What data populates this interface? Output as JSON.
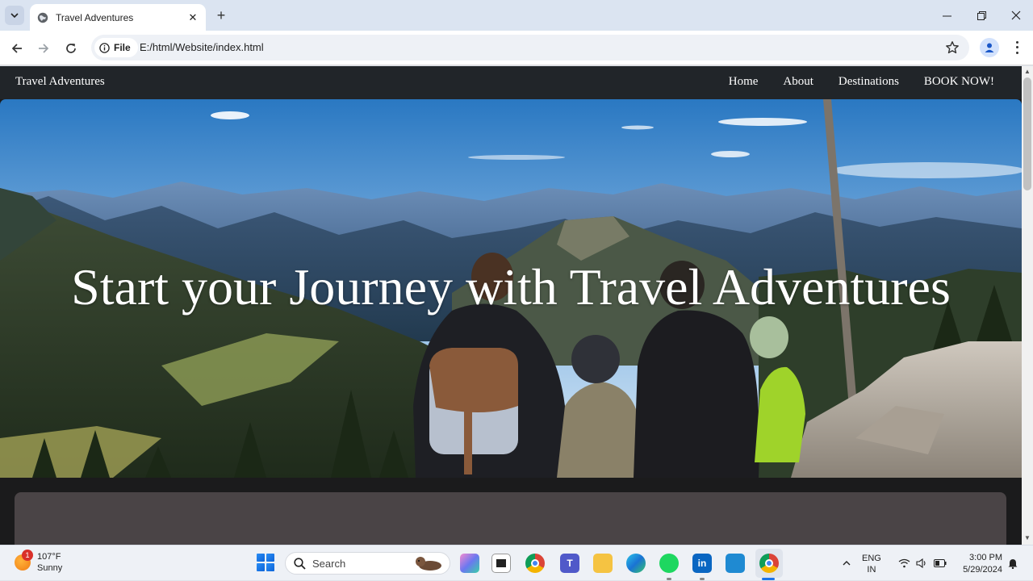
{
  "browser": {
    "tab_title": "Travel Adventures",
    "url_chip": "File",
    "url": "E:/html/Website/index.html",
    "icons": {
      "tab_search": "chevron-down-icon",
      "favicon": "globe-icon",
      "tab_close": "close-icon",
      "new_tab": "plus-icon",
      "back": "arrow-left-icon",
      "forward": "arrow-right-icon",
      "reload": "reload-icon",
      "info": "info-icon",
      "bookmark": "star-icon",
      "profile": "person-icon",
      "menu": "more-vertical-icon",
      "minimize": "minimize-icon",
      "restore": "restore-icon",
      "close_window": "close-icon"
    }
  },
  "site": {
    "brand": "Travel Adventures",
    "nav": [
      {
        "label": "Home"
      },
      {
        "label": "About"
      },
      {
        "label": "Destinations"
      },
      {
        "label": "BOOK NOW!"
      }
    ],
    "hero_title": "Start your Journey with Travel Adventures",
    "colors": {
      "navbar": "#212529",
      "page_bg": "#1b1b1c",
      "card": "#4a4446",
      "sky_top": "#1f6fb8",
      "sky_bottom": "#d8e8f6"
    }
  },
  "taskbar": {
    "weather_temp": "107°F",
    "weather_cond": "Sunny",
    "weather_badge": "1",
    "search_placeholder": "Search",
    "apps": [
      "copilot",
      "task-view",
      "chrome",
      "teams",
      "file-explorer",
      "edge",
      "spotify",
      "linkedin",
      "vscode",
      "chrome-active"
    ],
    "lang_top": "ENG",
    "lang_bottom": "IN",
    "time": "3:00 PM",
    "date": "5/29/2024"
  }
}
